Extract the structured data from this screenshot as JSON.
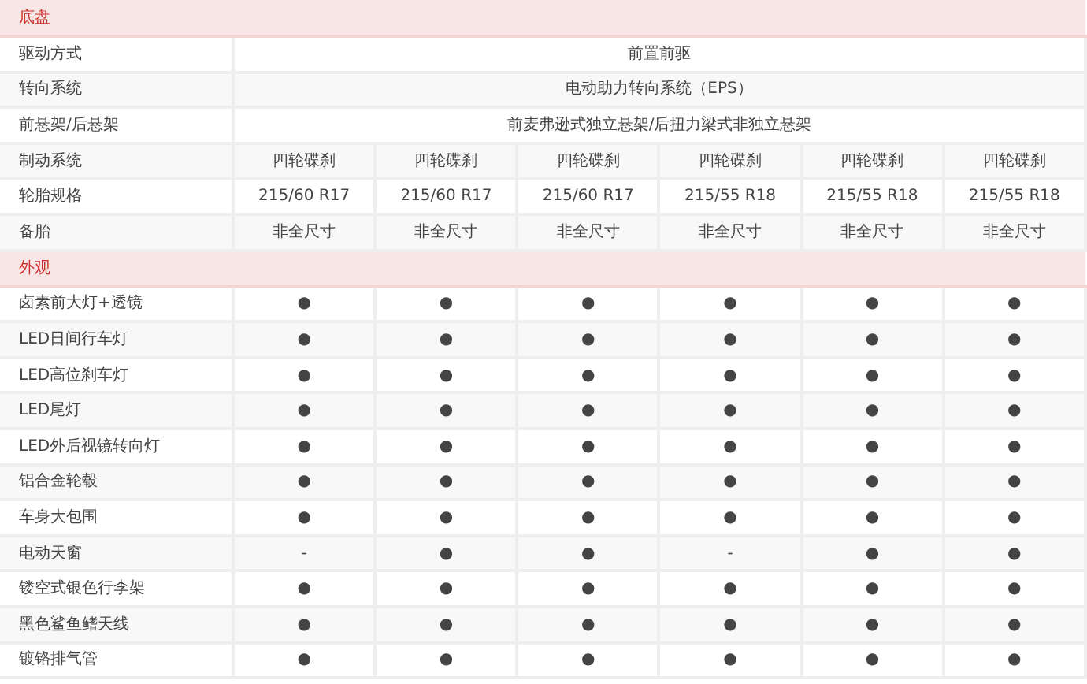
{
  "sections": [
    {
      "title": "底盘",
      "rows": [
        {
          "label": "驱动方式",
          "cells": [
            {
              "text": "前置前驱",
              "colspan": 6
            }
          ]
        },
        {
          "label": "转向系统",
          "cells": [
            {
              "text": "电动助力转向系统（EPS）",
              "colspan": 6
            }
          ]
        },
        {
          "label": "前悬架/后悬架",
          "cells": [
            {
              "text": "前麦弗逊式独立悬架/后扭力梁式非独立悬架",
              "colspan": 6
            }
          ]
        },
        {
          "label": "制动系统",
          "cells": [
            "四轮碟刹",
            "四轮碟刹",
            "四轮碟刹",
            "四轮碟刹",
            "四轮碟刹",
            "四轮碟刹"
          ]
        },
        {
          "label": "轮胎规格",
          "cells": [
            "215/60 R17",
            "215/60 R17",
            "215/60 R17",
            "215/55 R18",
            "215/55 R18",
            "215/55 R18"
          ]
        },
        {
          "label": "备胎",
          "cells": [
            "非全尺寸",
            "非全尺寸",
            "非全尺寸",
            "非全尺寸",
            "非全尺寸",
            "非全尺寸"
          ]
        }
      ]
    },
    {
      "title": "外观",
      "rows": [
        {
          "label": "卤素前大灯+透镜",
          "cells": [
            "●",
            "●",
            "●",
            "●",
            "●",
            "●"
          ]
        },
        {
          "label": "LED日间行车灯",
          "cells": [
            "●",
            "●",
            "●",
            "●",
            "●",
            "●"
          ]
        },
        {
          "label": "LED高位刹车灯",
          "cells": [
            "●",
            "●",
            "●",
            "●",
            "●",
            "●"
          ]
        },
        {
          "label": "LED尾灯",
          "cells": [
            "●",
            "●",
            "●",
            "●",
            "●",
            "●"
          ]
        },
        {
          "label": "LED外后视镜转向灯",
          "cells": [
            "●",
            "●",
            "●",
            "●",
            "●",
            "●"
          ]
        },
        {
          "label": "铝合金轮毂",
          "cells": [
            "●",
            "●",
            "●",
            "●",
            "●",
            "●"
          ]
        },
        {
          "label": "车身大包围",
          "cells": [
            "●",
            "●",
            "●",
            "●",
            "●",
            "●"
          ]
        },
        {
          "label": "电动天窗",
          "cells": [
            "-",
            "●",
            "●",
            "-",
            "●",
            "●"
          ]
        },
        {
          "label": "镂空式银色行李架",
          "cells": [
            "●",
            "●",
            "●",
            "●",
            "●",
            "●"
          ]
        },
        {
          "label": "黑色鲨鱼鳍天线",
          "cells": [
            "●",
            "●",
            "●",
            "●",
            "●",
            "●"
          ]
        },
        {
          "label": "镀铬排气管",
          "cells": [
            "●",
            "●",
            "●",
            "●",
            "●",
            "●"
          ]
        }
      ]
    }
  ]
}
